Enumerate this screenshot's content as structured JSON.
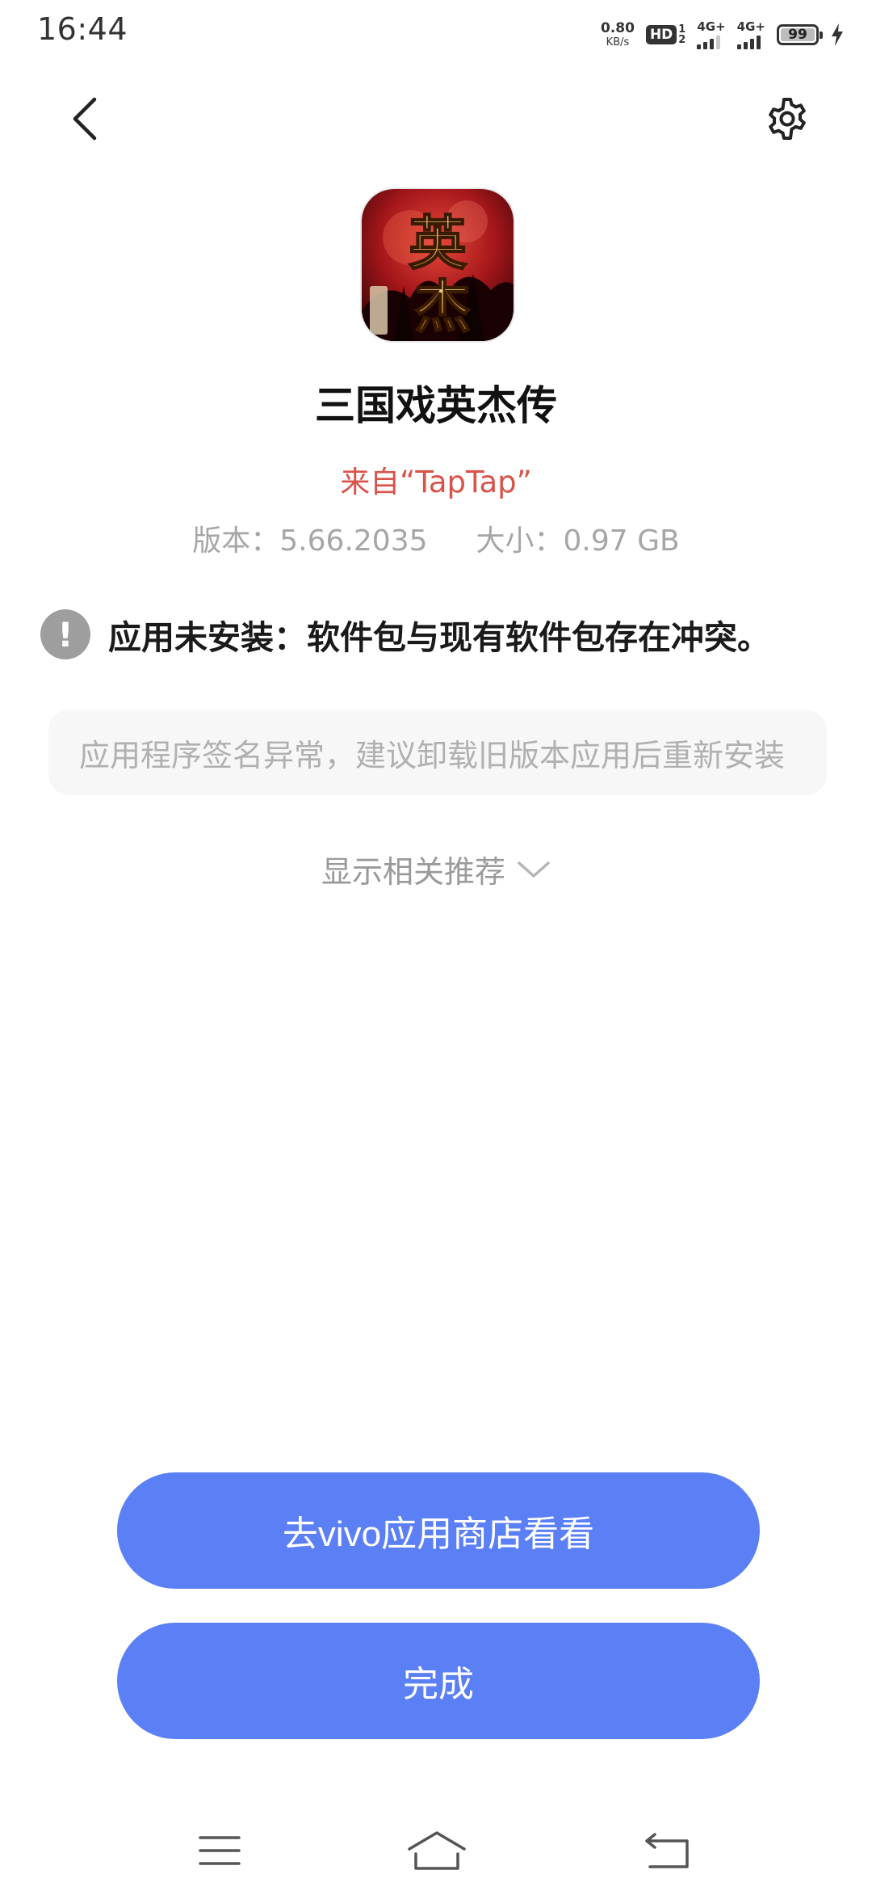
{
  "status_bar": {
    "time": "16:44",
    "net_speed_value": "0.80",
    "net_speed_unit": "KB/s",
    "hd_label": "HD",
    "sim_top": "1",
    "sim_bottom": "2",
    "signal_1_label": "4G+",
    "signal_2_label": "4G+",
    "battery_level": "99"
  },
  "nav": {
    "back_icon": "back-arrow-icon",
    "settings_icon": "gear-icon"
  },
  "app": {
    "name": "三国戏英杰传",
    "source": "来自“TapTap”",
    "version": "版本：5.66.2035",
    "size": "大小：0.97 GB"
  },
  "error": {
    "icon": "!",
    "message": "应用未安装：软件包与现有软件包存在冲突。",
    "detail": "应用程序签名异常，建议卸载旧版本应用后重新安装"
  },
  "recommend": {
    "label": "显示相关推荐"
  },
  "buttons": {
    "store_label": "去vivo应用商店看看",
    "done_label": "完成"
  },
  "colors": {
    "accent": "#5b7ff5",
    "source_red": "#d9534a",
    "muted": "#a6a6a6"
  }
}
